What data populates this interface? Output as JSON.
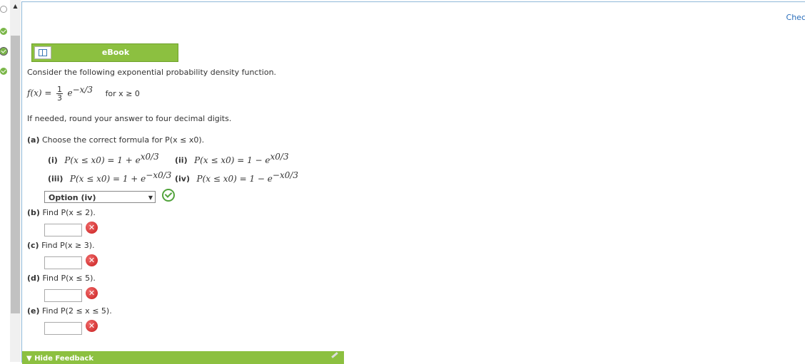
{
  "header": {
    "check_link": "Chec"
  },
  "ebook": {
    "label": "eBook"
  },
  "question": {
    "intro": "Consider the following exponential probability density function.",
    "pdf_lhs": "f(x) =",
    "pdf_num": "1",
    "pdf_den": "3",
    "pdf_base": "e",
    "pdf_exp": "−x/3",
    "pdf_domain": "for x ≥ 0",
    "round_note": "If needed, round your answer to four decimal digits."
  },
  "part_a": {
    "tag": "(a)",
    "prompt": "Choose the correct formula for P(x ≤ x0).",
    "options": [
      {
        "tag": "(i)",
        "lhs": "P(x ≤ x0) = 1 + e",
        "exp": "x0/3"
      },
      {
        "tag": "(ii)",
        "lhs": "P(x ≤ x0) = 1 − e",
        "exp": "x0/3"
      },
      {
        "tag": "(iii)",
        "lhs": "P(x ≤ x0) = 1 + e",
        "exp": "−x0/3"
      },
      {
        "tag": "(iv)",
        "lhs": "P(x ≤ x0) = 1 − e",
        "exp": "−x0/3"
      }
    ],
    "selected": "Option (iv)"
  },
  "part_b": {
    "tag": "(b)",
    "prompt": "Find P(x ≤ 2).",
    "value": ""
  },
  "part_c": {
    "tag": "(c)",
    "prompt": "Find P(x ≥ 3).",
    "value": ""
  },
  "part_d": {
    "tag": "(d)",
    "prompt": "Find P(x ≤ 5).",
    "value": ""
  },
  "part_e": {
    "tag": "(e)",
    "prompt": "Find P(2 ≤ x ≤ 5).",
    "value": ""
  },
  "feedback": {
    "label": "Hide Feedback"
  },
  "colors": {
    "accent_green": "#8cc040",
    "error_red": "#c81e1e",
    "ok_green": "#52a33c",
    "link_blue": "#2a6ebb"
  }
}
